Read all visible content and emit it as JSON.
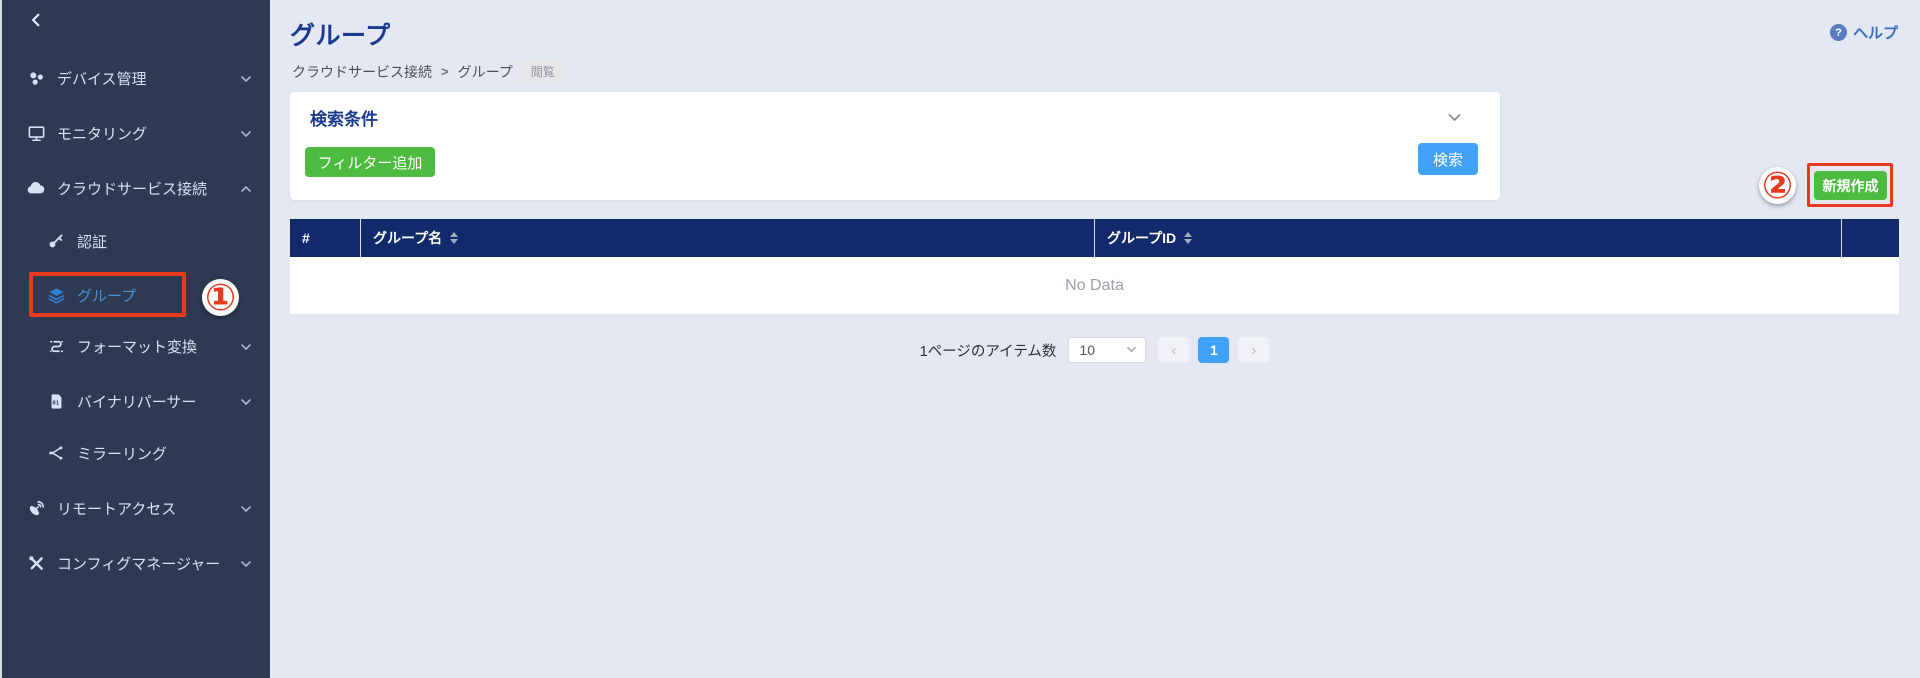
{
  "colors": {
    "sidebar_bg": "#2d3a52",
    "sidebar_text": "#d7e1f4",
    "active_blue": "#4a90d9",
    "page_bg": "#e3e8f2",
    "title_navy": "#1d3b8e",
    "table_header_bg": "#12296b",
    "green": "#4cbb3f",
    "blue": "#3fa2f7",
    "annotation_red": "#e8391d",
    "help_blue": "#3a6cc4"
  },
  "sidebar": {
    "items": [
      {
        "label": "デバイス管理",
        "icon": "devices-icon",
        "chevron": "down"
      },
      {
        "label": "モニタリング",
        "icon": "monitor-icon",
        "chevron": "down"
      },
      {
        "label": "クラウドサービス接続",
        "icon": "cloud-icon",
        "chevron": "up"
      },
      {
        "label": "認証",
        "icon": "key-icon",
        "chevron": ""
      },
      {
        "label": "グループ",
        "icon": "layers-icon",
        "chevron": "",
        "active": true
      },
      {
        "label": "フォーマット変換",
        "icon": "format-convert-icon",
        "chevron": "down"
      },
      {
        "label": "バイナリパーサー",
        "icon": "binary-file-icon",
        "chevron": "down"
      },
      {
        "label": "ミラーリング",
        "icon": "share-icon",
        "chevron": ""
      },
      {
        "label": "リモートアクセス",
        "icon": "satellite-icon",
        "chevron": "down"
      },
      {
        "label": "コンフィグマネージャー",
        "icon": "tools-icon",
        "chevron": "down"
      }
    ]
  },
  "header": {
    "title": "グループ",
    "help_label": "ヘルプ",
    "help_icon_glyph": "?"
  },
  "breadcrumb": {
    "items": [
      "クラウドサービス接続",
      "グループ"
    ],
    "separator": ">",
    "badge": "閲覧"
  },
  "search_panel": {
    "title": "検索条件",
    "add_filter_label": "フィルター追加",
    "search_label": "検索"
  },
  "create_button": {
    "label": "新規作成"
  },
  "annotations": {
    "step1": "①",
    "step2": "②"
  },
  "table": {
    "columns": [
      "#",
      "グループ名",
      "グループID",
      ""
    ],
    "empty_text": "No Data"
  },
  "pagination": {
    "items_per_page_label": "1ページのアイテム数",
    "items_per_page_value": "10",
    "current_page": "1",
    "prev_glyph": "‹",
    "next_glyph": "›"
  }
}
